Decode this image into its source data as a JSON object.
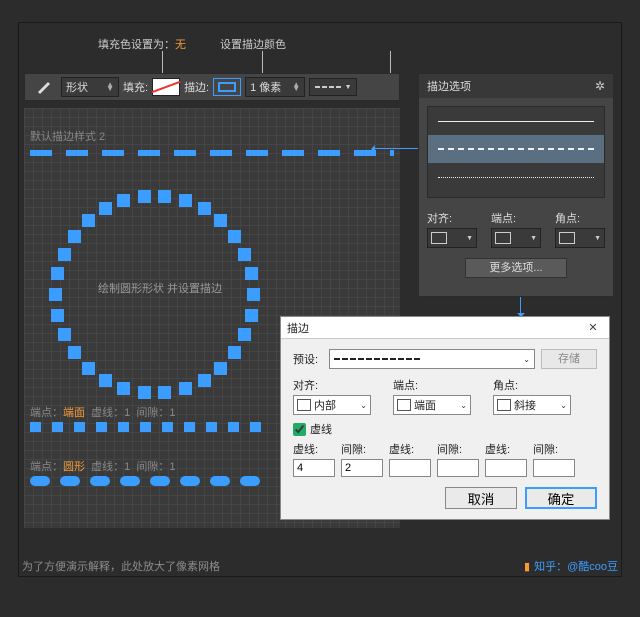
{
  "annotations": {
    "fill_set_to": "填充色设置为：",
    "none_word": "无",
    "set_stroke_color": "设置描边颜色"
  },
  "toolbar": {
    "shape_label": "形状",
    "fill_label": "填充:",
    "stroke_label": "描边:",
    "stroke_width": "1 像素"
  },
  "canvas": {
    "default_style": "默认描边样式 2",
    "circle_hint": "绘制圆形形状 并设置描边",
    "row1": {
      "cap": "端点：",
      "cap_val": "端面",
      "dash": "虚线：",
      "dash_val": "1",
      "gap": "间隙：",
      "gap_val": "1"
    },
    "row2": {
      "cap": "端点：",
      "cap_val": "圆形",
      "dash": "虚线：",
      "dash_val": "1",
      "gap": "间隙：",
      "gap_val": "1"
    }
  },
  "panel": {
    "title": "描边选项",
    "align": "对齐:",
    "cap": "端点:",
    "corner": "角点:",
    "more": "更多选项..."
  },
  "dialog": {
    "title": "描边",
    "preset": "预设:",
    "save": "存储",
    "align": "对齐:",
    "align_val": "内部",
    "cap": "端点:",
    "cap_val": "端面",
    "corner": "角点:",
    "corner_val": "斜接",
    "dash_chk": "虚线",
    "h_dash": "虚线:",
    "h_gap": "间隙:",
    "v_dash1": "4",
    "v_gap1": "2",
    "cancel": "取消",
    "ok": "确定"
  },
  "footer": {
    "left": "为了方便演示解释，此处放大了像素网格",
    "right": "知乎：@酷coo豆"
  }
}
